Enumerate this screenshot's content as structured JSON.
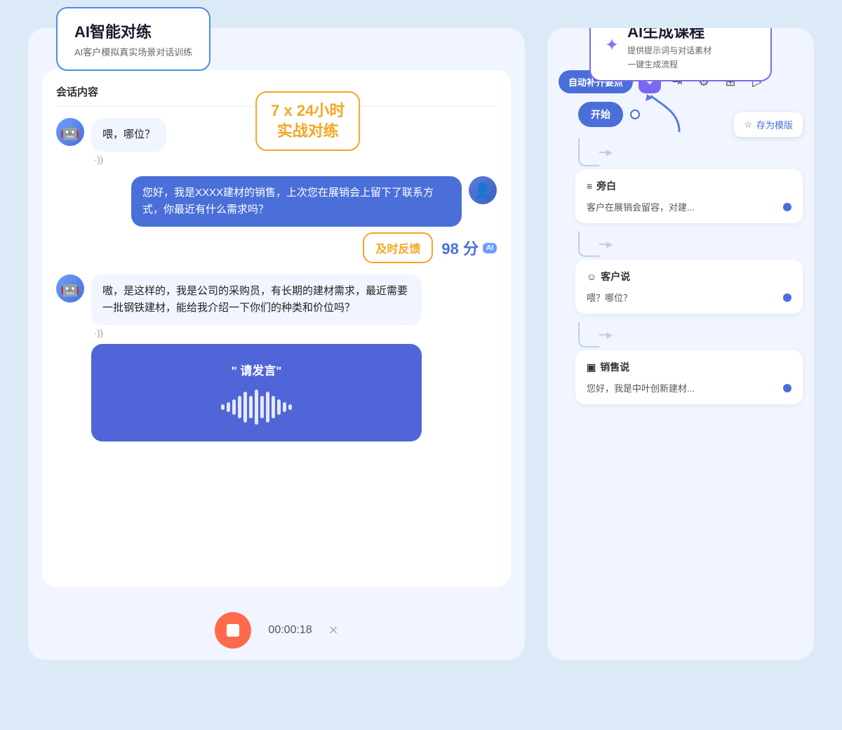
{
  "app": {
    "bg_color": "#dce9f7"
  },
  "left_panel": {
    "ai_label": {
      "title": "AI智能对练",
      "subtitle": "AI客户模拟真实场景对话训练"
    },
    "realtime_badge": {
      "line1": "7 x 24小时",
      "line2": "实战对练"
    },
    "chat_header": "会话内容",
    "messages": [
      {
        "id": "msg1",
        "type": "left",
        "text": "喂，哪位？",
        "sound": "·))"
      },
      {
        "id": "msg2",
        "type": "right",
        "text": "您好，我是XXXX建材的销售，上次您在展销会上留下了联系方式，你最近有什么需求吗？"
      },
      {
        "id": "msg3",
        "type": "score",
        "feedback_label": "及时反馈",
        "score": "98 分",
        "ai_tag": "AI"
      },
      {
        "id": "msg4",
        "type": "left",
        "text": "嗷，是这样的，我是公司的采购员，有长期的建材需求，最近需要一批钢铁建材，能给我介绍一下你们的种类和价位吗？",
        "sound": "·))"
      }
    ],
    "voice_input": {
      "label": "\" 请发言\"",
      "wave_bars": [
        3,
        6,
        12,
        18,
        24,
        18,
        30,
        18,
        24,
        18,
        12,
        6,
        3
      ]
    },
    "bottom_controls": {
      "timer": "00:00:18",
      "close_label": "×"
    }
  },
  "right_panel": {
    "ai_course": {
      "title": "AI生成课程",
      "subtitle1": "提供提示词与对话素材",
      "subtitle2": "一键生成流程"
    },
    "toolbar": {
      "auto_fill": "自动补齐要点",
      "magic_icon": "✦",
      "import_icon": "⇥",
      "settings_icon": "⚙",
      "layout_icon": "⊞",
      "play_icon": "▷"
    },
    "save_template": "存为模版",
    "flow": {
      "start_label": "开始",
      "cards": [
        {
          "id": "aside-card",
          "type": "旁白",
          "icon": "≡",
          "content": "客户在展销会留容，对建... ",
          "has_dot": true
        },
        {
          "id": "customer-card",
          "type": "客户说",
          "icon": "☺",
          "content": "喂？哪位？",
          "has_dot": true
        },
        {
          "id": "sales-card",
          "type": "销售说",
          "icon": "▣",
          "content": "您好，我是中叶创新建材... ",
          "has_dot": true
        }
      ]
    }
  }
}
